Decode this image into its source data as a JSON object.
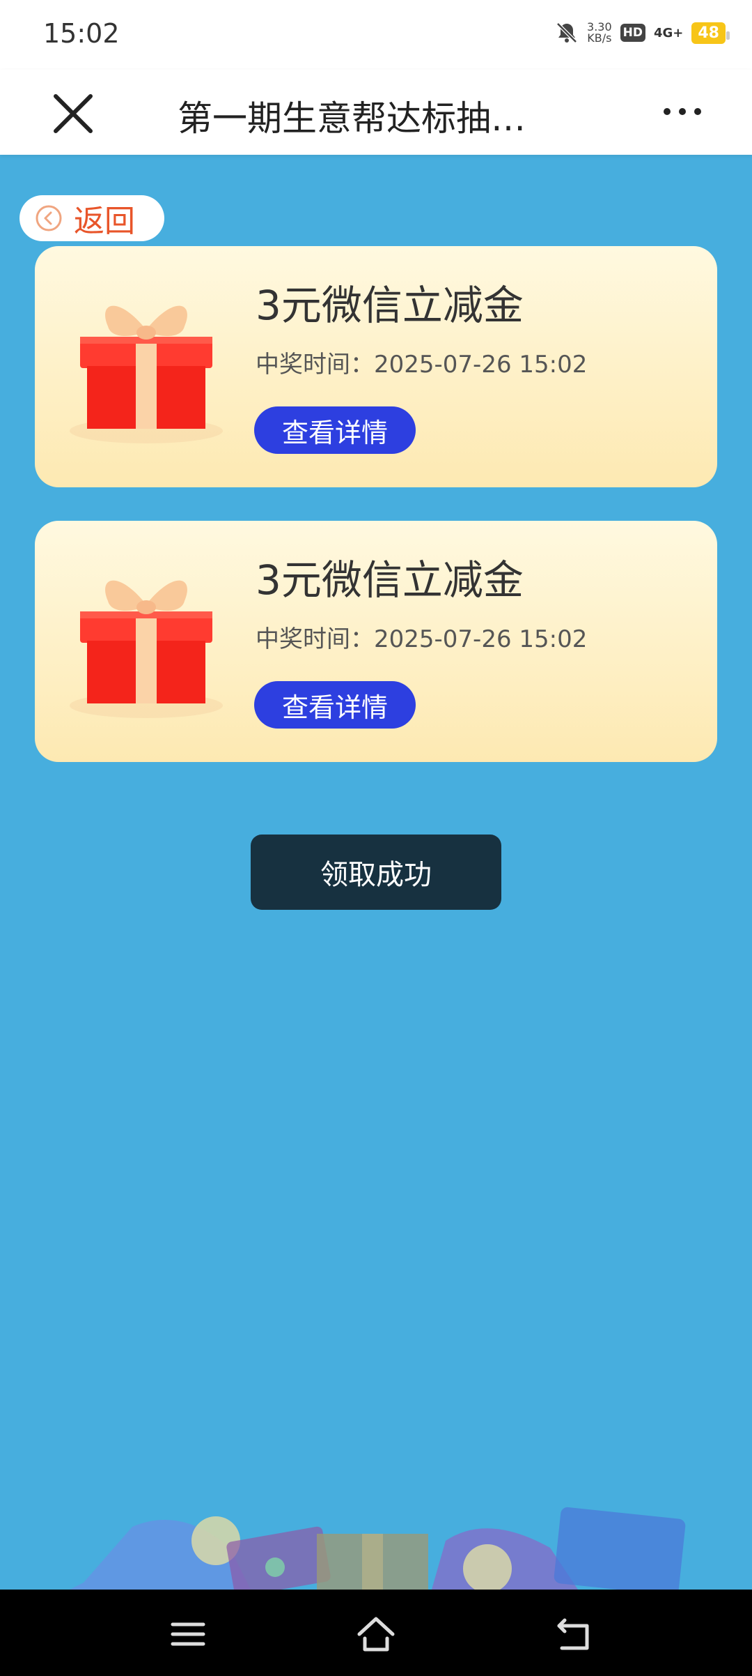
{
  "status_bar": {
    "time": "15:02",
    "speed_value": "3.30",
    "speed_unit": "KB/s",
    "hd": "HD",
    "network": "4G+",
    "battery": "48"
  },
  "header": {
    "title": "第一期生意帮达标抽…"
  },
  "back_button": {
    "label": "返回"
  },
  "prizes": [
    {
      "title": "3元微信立减金",
      "time_label": "中奖时间：",
      "time_value": "2025-07-26 15:02",
      "button_label": "查看详情"
    },
    {
      "title": "3元微信立减金",
      "time_label": "中奖时间：",
      "time_value": "2025-07-26 15:02",
      "button_label": "查看详情"
    }
  ],
  "toast": {
    "message": "领取成功"
  },
  "colors": {
    "background": "#47aede",
    "accent_button": "#2d3fe0",
    "back_text": "#e8552a",
    "battery": "#f7c518",
    "toast": "#173140"
  },
  "icons": {
    "close": "close-icon",
    "more": "more-icon",
    "back": "chevron-left-circle-icon",
    "gift": "gift-box-icon",
    "sys_menu": "menu-icon",
    "sys_home": "home-icon",
    "sys_back": "back-icon"
  }
}
